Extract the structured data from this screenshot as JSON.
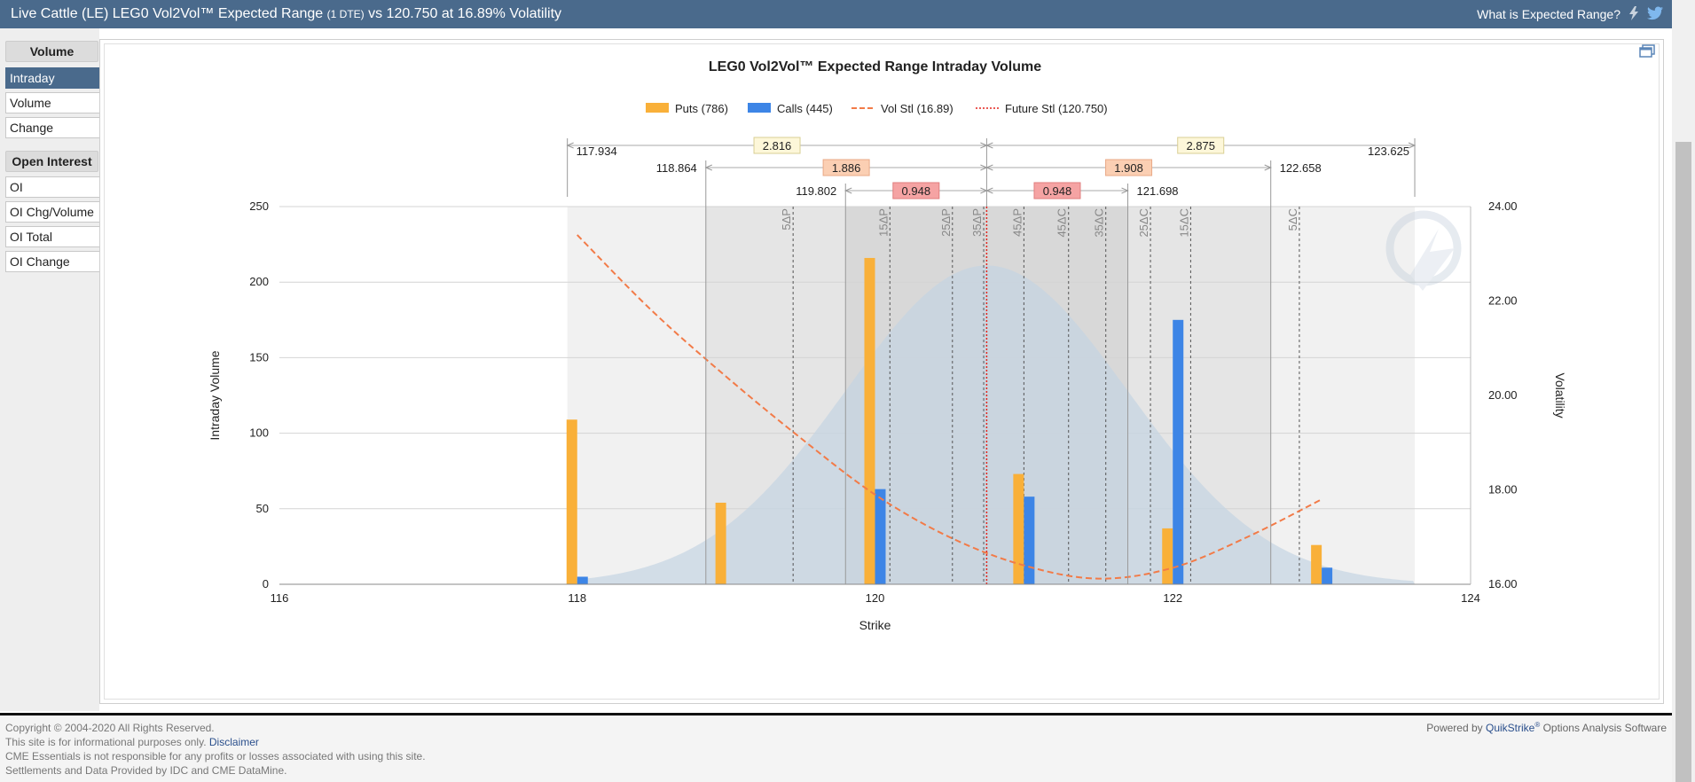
{
  "header": {
    "title_main": "Live Cattle (LE) LEG0 Vol2Vol™ Expected Range",
    "title_dte": "(1 DTE)",
    "title_rest": "vs 120.750 at 16.89% Volatility",
    "help_link": "What is Expected Range?",
    "lightning_icon": "lightning-icon",
    "twitter_icon": "twitter-icon"
  },
  "sidebar": {
    "volume_header": "Volume",
    "volume_items": [
      {
        "label": "Intraday",
        "active": true
      },
      {
        "label": "Volume",
        "active": false
      },
      {
        "label": "Change",
        "active": false
      }
    ],
    "oi_header": "Open Interest",
    "oi_items": [
      {
        "label": "OI"
      },
      {
        "label": "OI Chg/Volume"
      },
      {
        "label": "OI Total"
      },
      {
        "label": "OI Change"
      }
    ]
  },
  "colors": {
    "header_bg": "#4a6a8c",
    "puts": "#f9b039",
    "calls": "#3d85e6",
    "vol_line": "#f27b48",
    "future_line": "#e3251e",
    "bell": "#c5d4e2",
    "box1": "#fdf7d9",
    "box2": "#fbcfb3",
    "box3": "#f5a3a3"
  },
  "chart_data": {
    "type": "bar",
    "title": "LEG0 Vol2Vol™ Expected Range Intraday Volume",
    "xlabel": "Strike",
    "ylabel": "Intraday Volume",
    "y2label": "Volatility",
    "xlim": [
      116,
      124
    ],
    "x_ticks": [
      "116",
      "118",
      "120",
      "122",
      "124"
    ],
    "ylim": [
      0,
      250
    ],
    "y_ticks": [
      "0",
      "50",
      "100",
      "150",
      "200",
      "250"
    ],
    "y2lim": [
      16,
      24
    ],
    "y2_ticks": [
      "16.00",
      "18.00",
      "20.00",
      "22.00",
      "24.00"
    ],
    "grid": true,
    "legend_position": "top",
    "legend": [
      {
        "label": "Puts (786)",
        "kind": "bar",
        "color": "#f9b039"
      },
      {
        "label": "Calls (445)",
        "kind": "bar",
        "color": "#3d85e6"
      },
      {
        "label": "Vol Stl (16.89)",
        "kind": "dash",
        "color": "#f27b48"
      },
      {
        "label": "Future Stl (120.750)",
        "kind": "dot",
        "color": "#e3251e"
      }
    ],
    "series": [
      {
        "name": "Puts",
        "x": [
          118,
          119,
          120,
          121,
          122,
          123
        ],
        "values": [
          109,
          54,
          216,
          73,
          37,
          26
        ]
      },
      {
        "name": "Calls",
        "x": [
          118,
          120,
          121,
          122,
          123
        ],
        "values": [
          5,
          63,
          58,
          175,
          11
        ]
      },
      {
        "name": "Vol Stl",
        "x": [
          118,
          118.5,
          119,
          119.5,
          120,
          120.5,
          121,
          121.5,
          122,
          122.5,
          123
        ],
        "values": [
          23.4,
          21.8,
          20.4,
          19.1,
          17.9,
          17.0,
          16.4,
          16.12,
          16.35,
          17.0,
          17.8
        ]
      }
    ],
    "future_stl": 120.75,
    "ranges": [
      {
        "low": "117.934",
        "high": "123.625",
        "low_val": 117.934,
        "high_val": 123.625,
        "left_width": "2.816",
        "right_width": "2.875"
      },
      {
        "low": "118.864",
        "high": "122.658",
        "low_val": 118.864,
        "high_val": 122.658,
        "left_width": "1.886",
        "right_width": "1.908"
      },
      {
        "low": "119.802",
        "high": "121.698",
        "low_val": 119.802,
        "high_val": 121.698,
        "left_width": "0.948",
        "right_width": "0.948"
      }
    ],
    "delta_lines": [
      {
        "label": "5ΔP",
        "x": 119.45
      },
      {
        "label": "15ΔP",
        "x": 120.1
      },
      {
        "label": "25ΔP",
        "x": 120.52
      },
      {
        "label": "35ΔP",
        "x": 120.73
      },
      {
        "label": "45ΔP",
        "x": 121.0
      },
      {
        "label": "45ΔC",
        "x": 121.3
      },
      {
        "label": "35ΔC",
        "x": 121.55
      },
      {
        "label": "25ΔC",
        "x": 121.85
      },
      {
        "label": "15ΔC",
        "x": 122.12
      },
      {
        "label": "5ΔC",
        "x": 122.85
      }
    ]
  },
  "footer": {
    "copyright": "Copyright © 2004-2020 All Rights Reserved.",
    "info_prefix": "This site is for informational purposes only.",
    "disclaimer": "Disclaimer",
    "responsibility": "CME Essentials is not responsible for any profits or losses associated with using this site.",
    "settlements": "Settlements and Data Provided by IDC and CME DataMine.",
    "powered_prefix": "Powered by",
    "powered_link": "QuikStrike",
    "powered_suffix": "Options Analysis Software"
  }
}
